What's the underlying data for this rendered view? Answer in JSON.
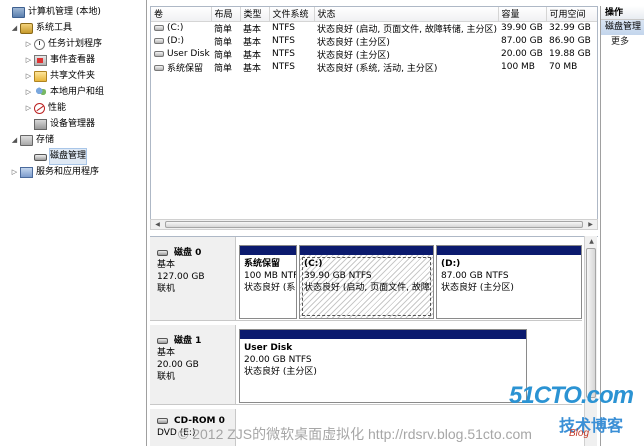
{
  "tree": {
    "root": "计算机管理 (本地)",
    "system_tools": "系统工具",
    "task_scheduler": "任务计划程序",
    "event_viewer": "事件查看器",
    "shared_folders": "共享文件夹",
    "local_users": "本地用户和组",
    "performance": "性能",
    "device_manager": "设备管理器",
    "storage": "存储",
    "disk_management": "磁盘管理",
    "services": "服务和应用程序"
  },
  "volumes": {
    "headers": [
      "卷",
      "布局",
      "类型",
      "文件系统",
      "状态",
      "容量",
      "可用空间"
    ],
    "rows": [
      [
        "(C:)",
        "简单",
        "基本",
        "NTFS",
        "状态良好 (启动, 页面文件, 故障转储, 主分区)",
        "39.90 GB",
        "32.99 GB"
      ],
      [
        "(D:)",
        "简单",
        "基本",
        "NTFS",
        "状态良好 (主分区)",
        "87.00 GB",
        "86.90 GB"
      ],
      [
        "User Disk",
        "简单",
        "基本",
        "NTFS",
        "状态良好 (主分区)",
        "20.00 GB",
        "19.88 GB"
      ],
      [
        "系统保留",
        "简单",
        "基本",
        "NTFS",
        "状态良好 (系统, 活动, 主分区)",
        "100 MB",
        "70 MB"
      ]
    ]
  },
  "disks": {
    "disk0": {
      "name": "磁盘 0",
      "type": "基本",
      "size": "127.00 GB",
      "status": "联机",
      "parts": [
        {
          "name": "系统保留",
          "size": "100 MB NTFS",
          "status": "状态良好 (系"
        },
        {
          "name": "(C:)",
          "size": "39.90 GB NTFS",
          "status": "状态良好 (启动, 页面文件, 故障"
        },
        {
          "name": "(D:)",
          "size": "87.00 GB NTFS",
          "status": "状态良好 (主分区)"
        }
      ]
    },
    "disk1": {
      "name": "磁盘 1",
      "type": "基本",
      "size": "20.00 GB",
      "status": "联机",
      "parts": [
        {
          "name": "User Disk",
          "size": "20.00 GB NTFS",
          "status": "状态良好 (主分区)"
        }
      ]
    },
    "cdrom": {
      "name": "CD-ROM 0",
      "type": "DVD (E:)"
    }
  },
  "actions": {
    "header": "操作",
    "section": "磁盘管理",
    "more": "更多"
  },
  "watermark": "© 2012 ZJS的微软桌面虚拟化 http://rdsrv.blog.51cto.com",
  "logo": {
    "main": "51CTO.com",
    "line2": "技术博客",
    "line3": "Blog"
  },
  "colors": {
    "primary_partition": "#0b1a6e",
    "selection": "#dfe9f5",
    "action_section": "#c3d5ec"
  }
}
